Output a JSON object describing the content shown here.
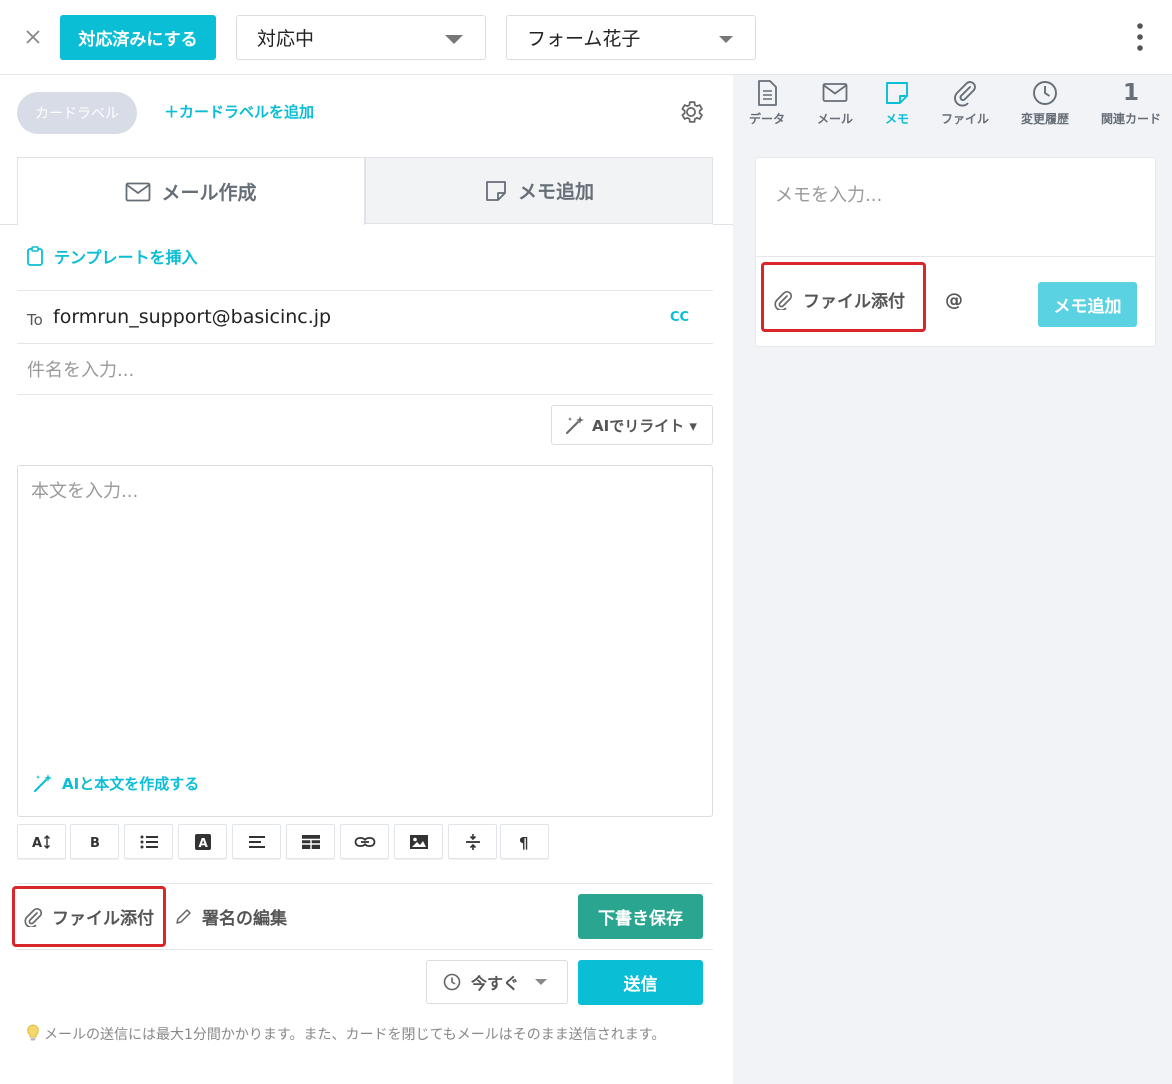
{
  "topbar": {
    "done_label": "対応済みにする",
    "status_value": "対応中",
    "assignee_value": "フォーム花子"
  },
  "card": {
    "label_chip": "カードラベル",
    "add_label": "＋カードラベルを追加"
  },
  "tabs": {
    "compose": "メール作成",
    "memo": "メモ追加"
  },
  "compose": {
    "template_link": "テンプレートを挿入",
    "to_label": "To",
    "to_value": "formrun_support@basicinc.jp",
    "cc_label": "CC",
    "subject_placeholder": "件名を入力...",
    "ai_rewrite": "AIでリライト ▾",
    "body_placeholder": "本文を入力...",
    "ai_compose": "AIと本文を作成する",
    "toolbar": [
      "A↕",
      "B",
      "list",
      "A",
      "align",
      "table",
      "link",
      "image",
      "height",
      "¶"
    ],
    "attach_label": "ファイル添付",
    "signature_label": "署名の編集",
    "draft_label": "下書き保存",
    "timing_label": "今すぐ",
    "send_label": "送信",
    "notice": "メールの送信には最大1分間かかります。また、カードを閉じてもメールはそのまま送信されます。"
  },
  "right_tabs": [
    {
      "label": "データ",
      "icon": "document-icon"
    },
    {
      "label": "メール",
      "icon": "mail-icon"
    },
    {
      "label": "メモ",
      "icon": "memo-icon"
    },
    {
      "label": "ファイル",
      "icon": "paperclip-icon"
    },
    {
      "label": "変更履歴",
      "icon": "clock-icon"
    },
    {
      "label": "関連カード",
      "count": "1"
    }
  ],
  "memo_panel": {
    "placeholder": "メモを入力...",
    "attach_label": "ファイル添付",
    "mention": "@",
    "add_button": "メモ追加"
  },
  "colors": {
    "accent": "#0abed6",
    "draft": "#2aa58f",
    "highlight": "#d9262b"
  }
}
